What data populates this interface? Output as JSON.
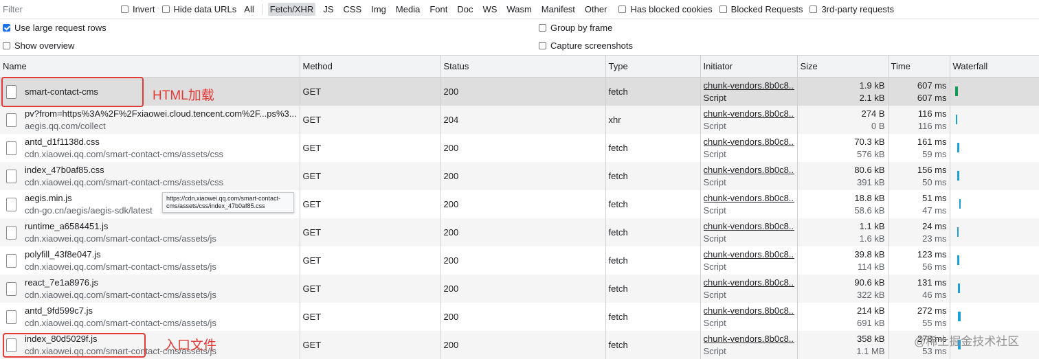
{
  "toolbar": {
    "filter_placeholder": "Filter",
    "invert_label": "Invert",
    "hide_data_urls_label": "Hide data URLs",
    "types": [
      "All",
      "Fetch/XHR",
      "JS",
      "CSS",
      "Img",
      "Media",
      "Font",
      "Doc",
      "WS",
      "Wasm",
      "Manifest",
      "Other"
    ],
    "active_type": "Fetch/XHR",
    "has_blocked_cookies_label": "Has blocked cookies",
    "blocked_requests_label": "Blocked Requests",
    "third_party_label": "3rd-party requests"
  },
  "options": {
    "large_rows_label": "Use large request rows",
    "large_rows_checked": true,
    "show_overview_label": "Show overview",
    "group_by_frame_label": "Group by frame",
    "capture_screenshots_label": "Capture screenshots"
  },
  "columns": {
    "name": "Name",
    "method": "Method",
    "status": "Status",
    "type": "Type",
    "initiator": "Initiator",
    "size": "Size",
    "time": "Time",
    "waterfall": "Waterfall"
  },
  "rows": [
    {
      "name": "smart-contact-cms",
      "path": "",
      "method": "GET",
      "status": "200",
      "type": "fetch",
      "initiator": "chunk-vendors.8b0c8...",
      "initiator_type": "Script",
      "size": "1.9 kB",
      "resource_size": "2.1 kB",
      "time": "607 ms",
      "latency": "607 ms"
    },
    {
      "name": "pv?from=https%3A%2F%2Fxiaowei.cloud.tencent.com%2F...ps%3...",
      "path": "aegis.qq.com/collect",
      "method": "GET",
      "status": "204",
      "type": "xhr",
      "initiator": "chunk-vendors.8b0c8...",
      "initiator_type": "Script",
      "size": "274 B",
      "resource_size": "0 B",
      "time": "116 ms",
      "latency": "116 ms"
    },
    {
      "name": "antd_d1f1138d.css",
      "path": "cdn.xiaowei.qq.com/smart-contact-cms/assets/css",
      "method": "GET",
      "status": "200",
      "type": "fetch",
      "initiator": "chunk-vendors.8b0c8...",
      "initiator_type": "Script",
      "size": "70.3 kB",
      "resource_size": "576 kB",
      "time": "161 ms",
      "latency": "59 ms"
    },
    {
      "name": "index_47b0af85.css",
      "path": "cdn.xiaowei.qq.com/smart-contact-cms/assets/css",
      "method": "GET",
      "status": "200",
      "type": "fetch",
      "initiator": "chunk-vendors.8b0c8...",
      "initiator_type": "Script",
      "size": "80.6 kB",
      "resource_size": "391 kB",
      "time": "156 ms",
      "latency": "50 ms"
    },
    {
      "name": "aegis.min.js",
      "path": "cdn-go.cn/aegis/aegis-sdk/latest",
      "method": "GET",
      "status": "200",
      "type": "fetch",
      "initiator": "chunk-vendors.8b0c8...",
      "initiator_type": "Script",
      "size": "18.8 kB",
      "resource_size": "58.6 kB",
      "time": "51 ms",
      "latency": "47 ms"
    },
    {
      "name": "runtime_a6584451.js",
      "path": "cdn.xiaowei.qq.com/smart-contact-cms/assets/js",
      "method": "GET",
      "status": "200",
      "type": "fetch",
      "initiator": "chunk-vendors.8b0c8...",
      "initiator_type": "Script",
      "size": "1.1 kB",
      "resource_size": "1.6 kB",
      "time": "24 ms",
      "latency": "23 ms"
    },
    {
      "name": "polyfill_43f8e047.js",
      "path": "cdn.xiaowei.qq.com/smart-contact-cms/assets/js",
      "method": "GET",
      "status": "200",
      "type": "fetch",
      "initiator": "chunk-vendors.8b0c8...",
      "initiator_type": "Script",
      "size": "39.8 kB",
      "resource_size": "114 kB",
      "time": "123 ms",
      "latency": "56 ms"
    },
    {
      "name": "react_7e1a8976.js",
      "path": "cdn.xiaowei.qq.com/smart-contact-cms/assets/js",
      "method": "GET",
      "status": "200",
      "type": "fetch",
      "initiator": "chunk-vendors.8b0c8...",
      "initiator_type": "Script",
      "size": "90.6 kB",
      "resource_size": "322 kB",
      "time": "131 ms",
      "latency": "46 ms"
    },
    {
      "name": "antd_9fd599c7.js",
      "path": "cdn.xiaowei.qq.com/smart-contact-cms/assets/js",
      "method": "GET",
      "status": "200",
      "type": "fetch",
      "initiator": "chunk-vendors.8b0c8...",
      "initiator_type": "Script",
      "size": "214 kB",
      "resource_size": "691 kB",
      "time": "272 ms",
      "latency": "55 ms"
    },
    {
      "name": "index_80d5029f.js",
      "path": "cdn.xiaowei.qq.com/smart-contact-cms/assets/js",
      "method": "GET",
      "status": "200",
      "type": "fetch",
      "initiator": "chunk-vendors.8b0c8...",
      "initiator_type": "Script",
      "size": "358 kB",
      "resource_size": "1.1 MB",
      "time": "278 ms",
      "latency": "53 ms"
    }
  ],
  "tooltip": {
    "text": "https://cdn.xiaowei.qq.com/smart-contact-cms/assets/css/index_47b0af85.css"
  },
  "annotations": {
    "html_load": "HTML加载",
    "entry_file": "入口文件"
  },
  "watermark": "@稀土掘金技术社区",
  "colors": {
    "annotation": "#e53935",
    "waterfall_first": "#0f9d58",
    "waterfall_other": "#1a9fd8",
    "checkbox_checked": "#1a73e8"
  }
}
